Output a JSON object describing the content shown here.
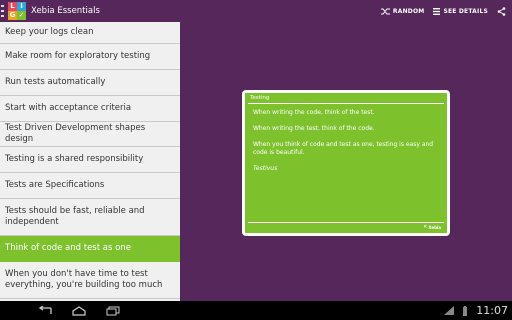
{
  "app": {
    "title": "Xebia Essentials",
    "logo_letters": [
      "L",
      "I",
      "G",
      "✓"
    ],
    "logo_colors": [
      "#e84a5f",
      "#2fa6d9",
      "#f0a020",
      "#7dc12c"
    ]
  },
  "actionbar": {
    "random_label": "RANDOM",
    "random_icon": "shuffle-icon",
    "see_details_label": "SEE DETAILS",
    "see_details_icon": "list-icon",
    "share_icon": "share-icon"
  },
  "list": {
    "items": [
      {
        "label": "Keep your logs clean",
        "active": false
      },
      {
        "label": "Make room for exploratory testing",
        "active": false
      },
      {
        "label": "Run tests automatically",
        "active": false
      },
      {
        "label": "Start with acceptance criteria",
        "active": false
      },
      {
        "label": "Test Driven Development shapes design",
        "active": false
      },
      {
        "label": "Testing is a shared responsibility",
        "active": false
      },
      {
        "label": "Tests are Specifications",
        "active": false
      },
      {
        "label": "Tests should be fast, reliable and independent",
        "active": false
      },
      {
        "label": "Think of code and test as one",
        "active": true
      },
      {
        "label": "When you don't have time to test everything, you're building too much",
        "active": false
      }
    ]
  },
  "card": {
    "category": "Testing",
    "paragraphs": [
      "When writing the code, think of the test.",
      "When writing the test, think of the code.",
      "When you think of code and test as one, testing is easy and code is beautiful."
    ],
    "author": "Testivus",
    "footer_logo": "Xebia"
  },
  "system": {
    "time": "11:07",
    "nav_icons": [
      "back-icon",
      "home-icon",
      "recent-apps-icon"
    ],
    "status_icons": [
      "wifi-icon",
      "battery-icon"
    ]
  },
  "colors": {
    "accent": "#7dc12c",
    "brand": "#55275a"
  }
}
